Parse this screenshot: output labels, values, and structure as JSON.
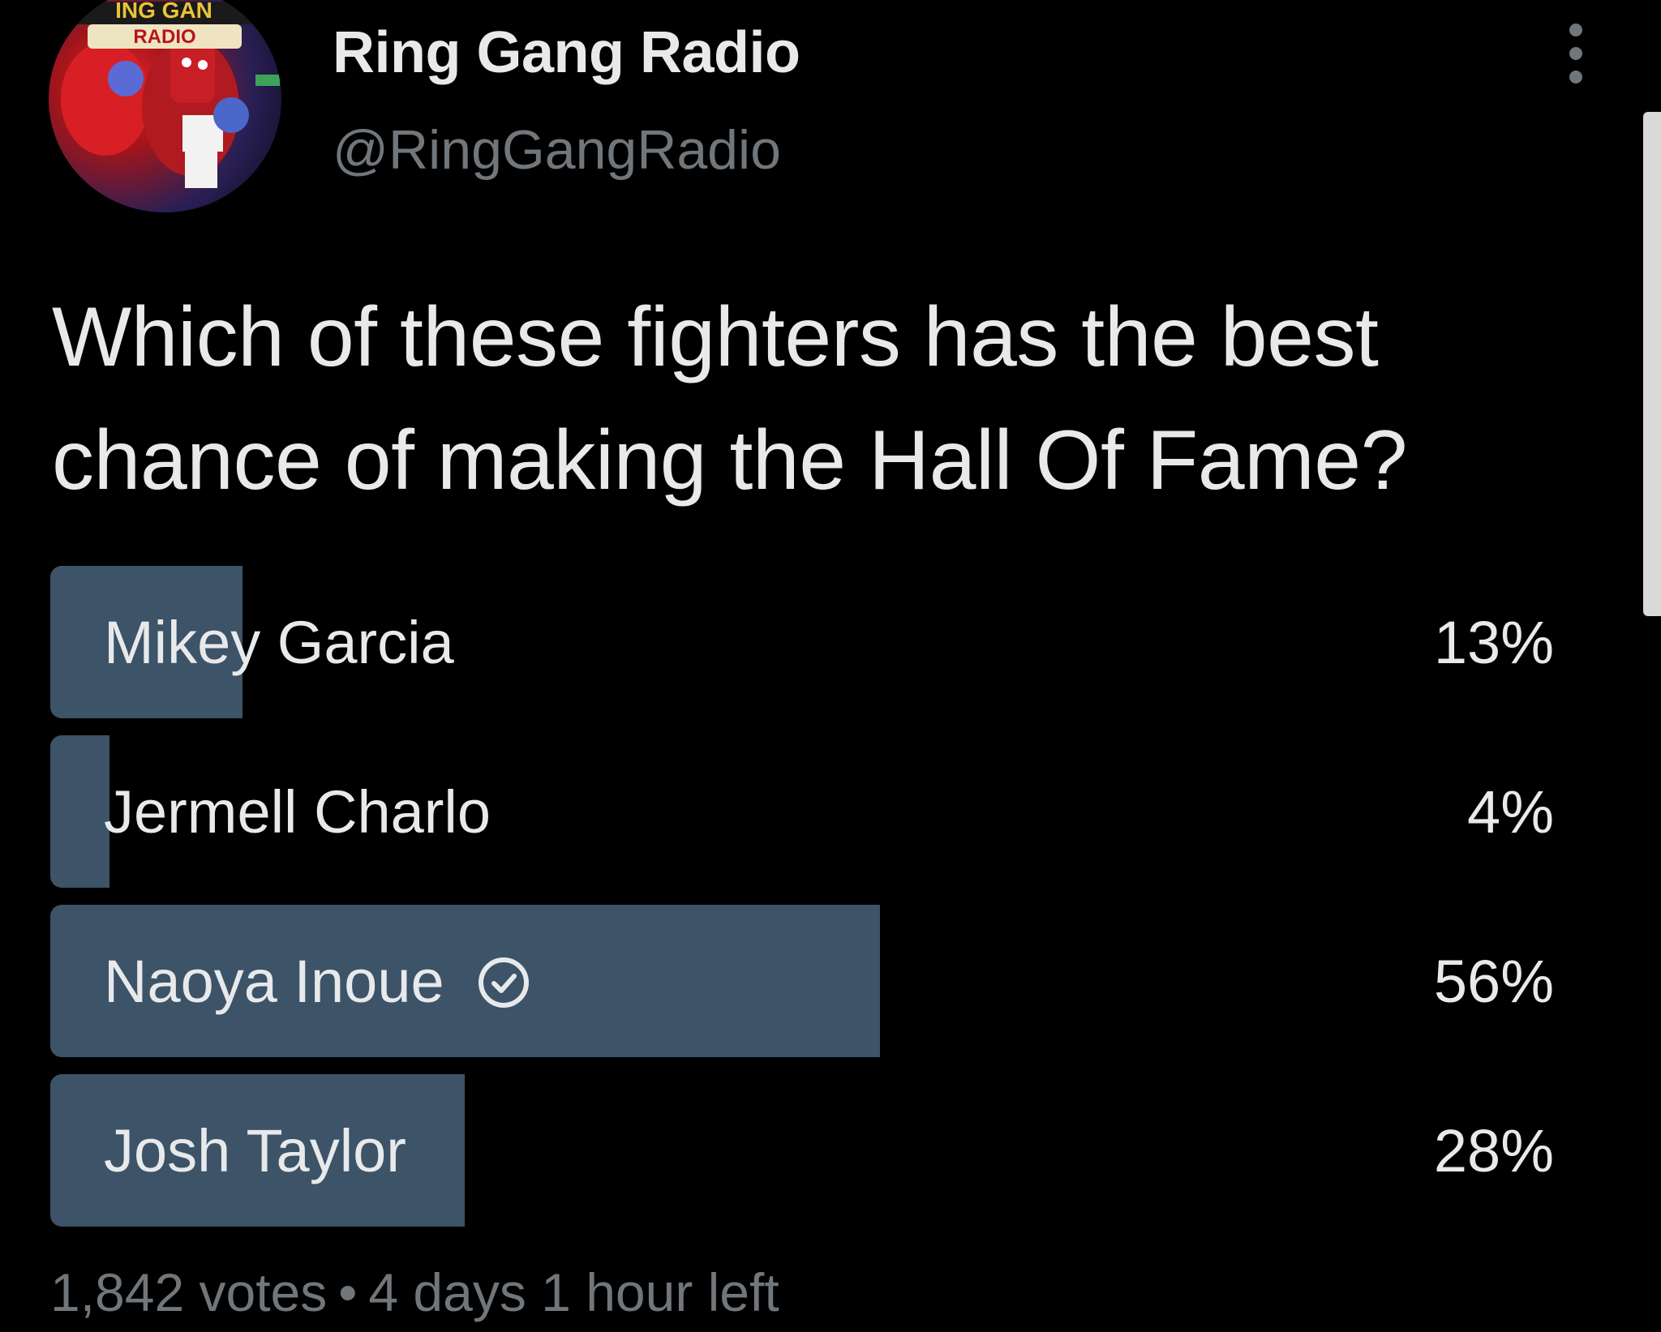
{
  "author": {
    "display_name": "Ring Gang Radio",
    "handle": "@RingGangRadio",
    "avatar_text_top": "ING GAN",
    "avatar_text_bottom": "RADIO"
  },
  "tweet": {
    "question_line1": "Which of these fighters has the best",
    "question_line2": "chance of making the Hall Of Fame?"
  },
  "poll": {
    "options": [
      {
        "label": "Mikey Garcia",
        "percent_text": "13%",
        "percent": 13,
        "winner": false
      },
      {
        "label": "Jermell Charlo",
        "percent_text": "4%",
        "percent": 4,
        "winner": false
      },
      {
        "label": "Naoya Inoue",
        "percent_text": "56%",
        "percent": 56,
        "winner": true
      },
      {
        "label": "Josh Taylor",
        "percent_text": "28%",
        "percent": 28,
        "winner": false
      }
    ],
    "votes": "1,842 votes",
    "separator": "•",
    "time_left": "4 days 1 hour left"
  },
  "colors": {
    "background": "#000000",
    "text_primary": "#e7e9ea",
    "text_secondary": "#71767b",
    "poll_fill": "#3c5368"
  }
}
